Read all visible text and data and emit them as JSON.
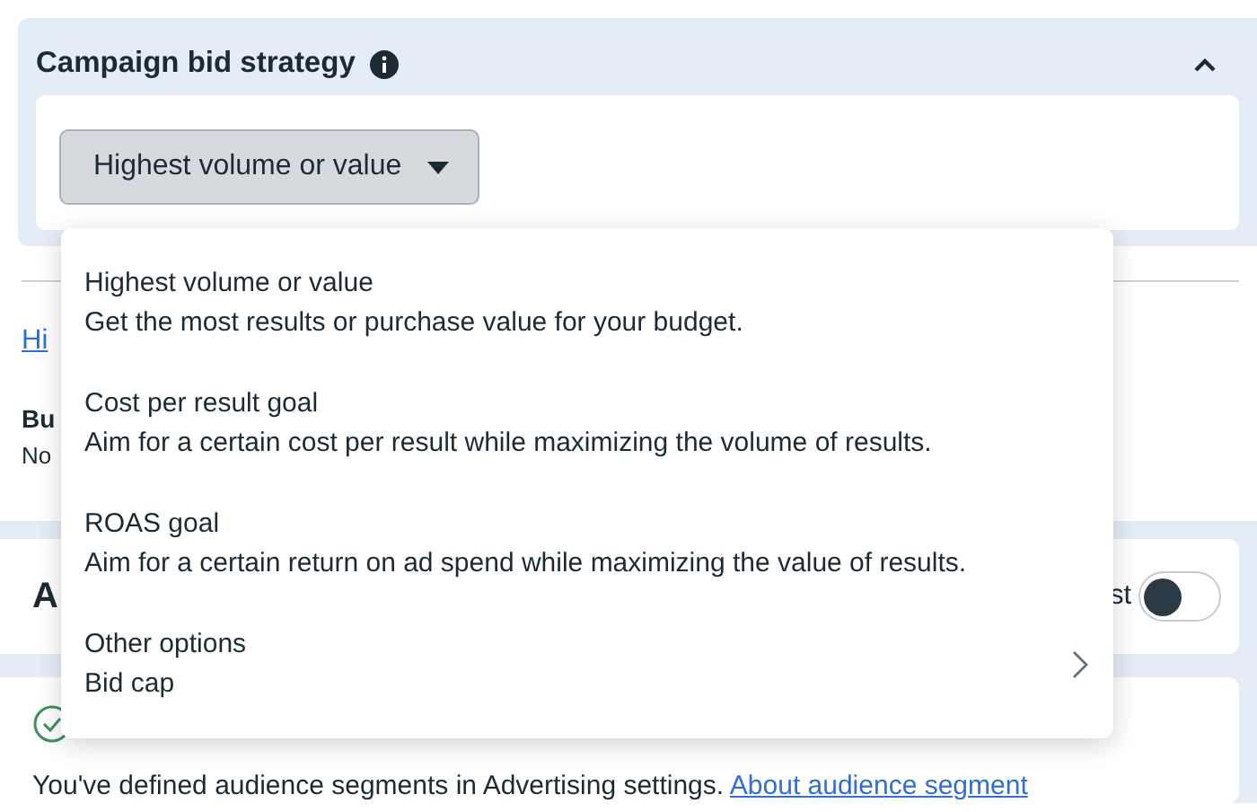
{
  "panel": {
    "title": "Campaign bid strategy",
    "expanded": true,
    "dropdown": {
      "value": "Highest volume or value",
      "open": true
    }
  },
  "menu": {
    "items": [
      {
        "kind": "option",
        "title": "Highest volume or value",
        "description": "Get the most results or purchase value for your budget."
      },
      {
        "kind": "option",
        "title": "Cost per result goal",
        "description": "Aim for a certain cost per result while maximizing the volume of results."
      },
      {
        "kind": "option",
        "title": "ROAS goal",
        "description": "Aim for a certain return on ad spend while maximizing the value of results."
      },
      {
        "kind": "submenu",
        "title": "Other options",
        "description": "Bid cap"
      }
    ]
  },
  "background": {
    "link": "Hi",
    "label": "Bu",
    "note": "No",
    "section_title": "A",
    "toggle_label": "st",
    "toggle": {
      "on": false
    },
    "notice": {
      "text": "You've defined audience segments in Advertising settings.",
      "link": "About audience segment"
    }
  }
}
